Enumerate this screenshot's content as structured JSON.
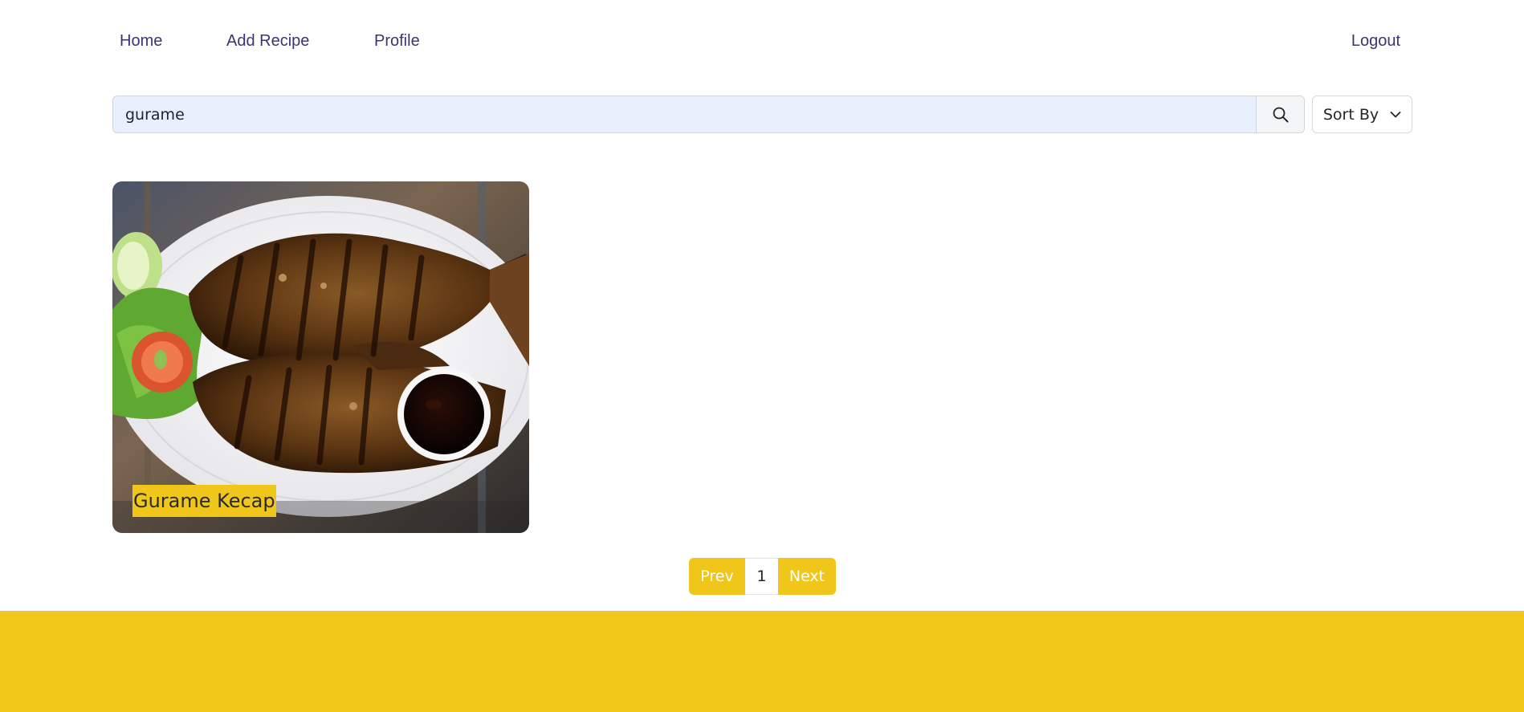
{
  "nav": {
    "home": "Home",
    "add_recipe": "Add Recipe",
    "profile": "Profile",
    "logout": "Logout"
  },
  "search": {
    "value": "gurame",
    "button_icon": "search-icon"
  },
  "sort": {
    "label": "Sort By",
    "icon": "chevron-down-icon"
  },
  "recipes": [
    {
      "title": "Gurame Kecap",
      "image": "grilled-fish-photo"
    }
  ],
  "pagination": {
    "prev": "Prev",
    "current": "1",
    "next": "Next"
  },
  "colors": {
    "accent": "#f0c61a",
    "nav_text": "#3b3470",
    "search_bg": "#e8f0fe",
    "footer": "#efc81a"
  }
}
